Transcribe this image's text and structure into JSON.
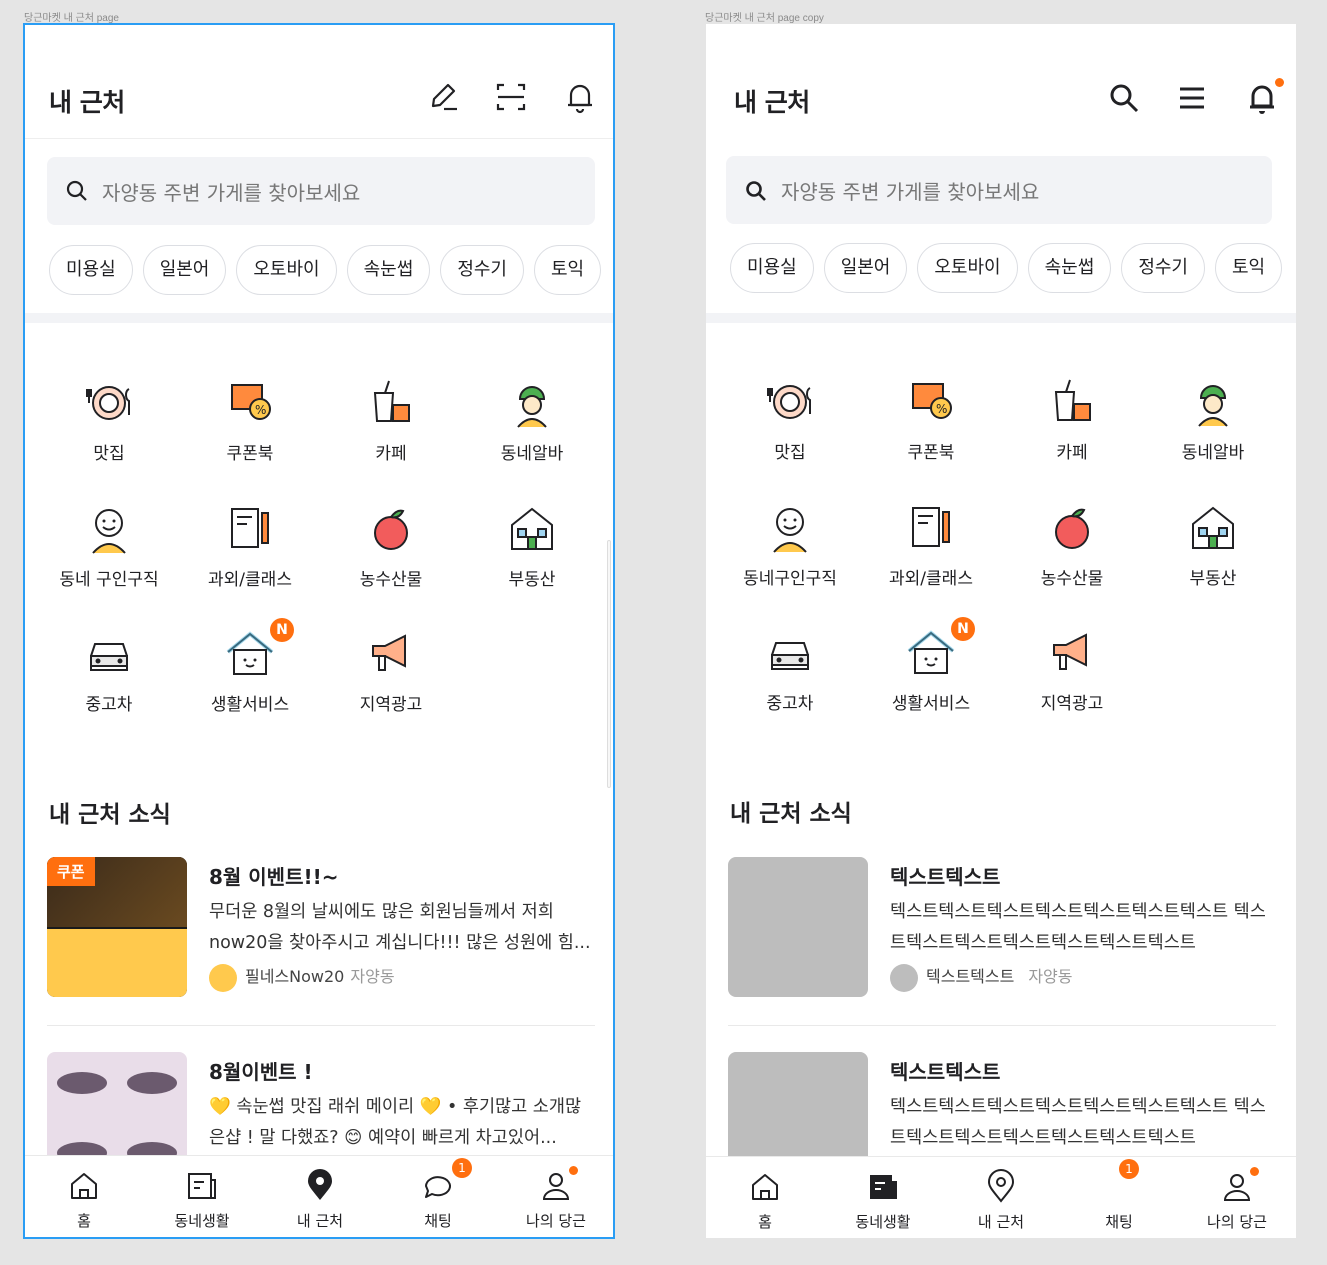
{
  "left_frame": {
    "label": "당근마켓 내 근처 page",
    "title": "내 근처",
    "header_icons": [
      "pencil-icon",
      "scan-icon",
      "bell-icon"
    ],
    "search_placeholder": "자양동 주변 가게를 찾아보세요",
    "chips": [
      "미용실",
      "일본어",
      "오토바이",
      "속눈썹",
      "정수기",
      "토익"
    ],
    "categories": [
      "맛집",
      "쿠폰북",
      "카페",
      "동네알바",
      "동네 구인구직",
      "과외/클래스",
      "농수산물",
      "부동산",
      "중고차",
      "생활서비스",
      "지역광고"
    ],
    "new_badge": "N",
    "section_title": "내 근처 소식",
    "news": [
      {
        "title": "8월 이벤트!!~",
        "body": "무더운 8월의 날씨에도 많은 회원님들께서 저희 now20을 찾아주시고 계십니다!!! 많은 성원에 힘...",
        "author": "필네스Now20",
        "location": "자양동",
        "thumb_tag": "쿠폰"
      },
      {
        "title": "8월이벤트 !",
        "body": "💛 속눈썹 맛집 래쉬 메이리 💛 • 후기많고 소개많은샵 ! 말 다했죠? 😊 예약이 빠르게 차고있어...",
        "author": "",
        "location": ""
      }
    ],
    "tabs": [
      "홈",
      "동네생활",
      "내 근처",
      "채팅",
      "나의 당근"
    ],
    "chat_badge": "1"
  },
  "right_frame": {
    "label": "당근마켓 내 근처 page copy",
    "title": "내 근처",
    "header_icons": [
      "search-icon",
      "menu-icon",
      "bell-icon"
    ],
    "search_placeholder": "자양동 주변 가게를 찾아보세요",
    "chips": [
      "미용실",
      "일본어",
      "오토바이",
      "속눈썹",
      "정수기",
      "토익"
    ],
    "categories": [
      "맛집",
      "쿠폰북",
      "카페",
      "동네알바",
      "동네구인구직",
      "과외/클래스",
      "농수산물",
      "부동산",
      "중고차",
      "생활서비스",
      "지역광고"
    ],
    "new_badge": "N",
    "section_title": "내 근처 소식",
    "news": [
      {
        "title": "텍스트텍스트",
        "body": "텍스트텍스트텍스트텍스트텍스트텍스트텍스트 텍스트텍스트텍스트텍스트텍스트텍스트텍스트",
        "author": "텍스트텍스트",
        "location": "자양동"
      },
      {
        "title": "텍스트텍스트",
        "body": "텍스트텍스트텍스트텍스트텍스트텍스트텍스트 텍스트텍스트텍스트텍스트텍스트텍스트텍스트",
        "author": "",
        "location": ""
      }
    ],
    "tabs": [
      "홈",
      "동네생활",
      "내 근처",
      "채팅",
      "나의 당근"
    ],
    "chat_badge": "1"
  },
  "colors": {
    "accent": "#ff6f0f",
    "selection": "#2a9df4",
    "search_bg": "#f2f3f6"
  }
}
